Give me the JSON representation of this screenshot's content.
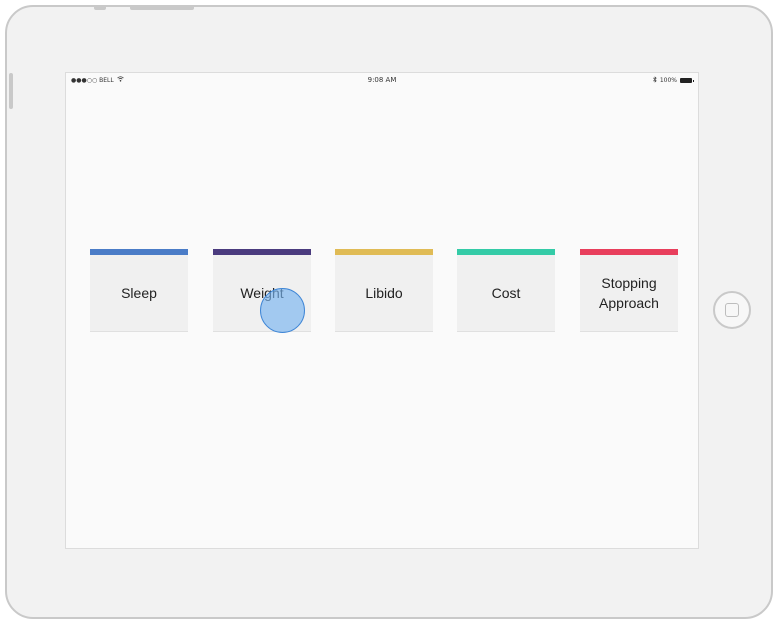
{
  "status_bar": {
    "carrier": "●●●○○ BELL",
    "time": "9:08 AM",
    "battery": "100%"
  },
  "cards": [
    {
      "label": "Sleep",
      "color": "#4a7cc7"
    },
    {
      "label": "Weight",
      "color": "#4a3b7e"
    },
    {
      "label": "Libido",
      "color": "#e0bb55"
    },
    {
      "label": "Cost",
      "color": "#34cba7"
    },
    {
      "label": "Stopping Approach",
      "color": "#e83e5c"
    }
  ]
}
